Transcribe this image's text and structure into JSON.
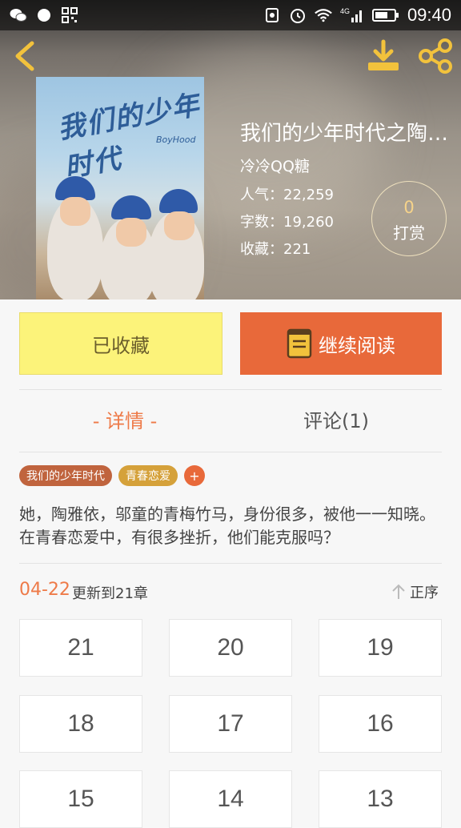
{
  "status_bar": {
    "time": "09:40",
    "network": "4G"
  },
  "book": {
    "cover_title": "我们的少年时代",
    "cover_subtitle": "BoyHood",
    "title": "我们的少年时代之陶…",
    "author": "冷冷QQ糖",
    "popularity_label": "人气：",
    "popularity": "22,259",
    "word_count_label": "字数：",
    "word_count": "19,260",
    "favorites_label": "收藏：",
    "favorites": "221"
  },
  "tip": {
    "count": "0",
    "label": "打赏"
  },
  "actions": {
    "collect_label": "已收藏",
    "read_label": "继续阅读"
  },
  "tabs": {
    "detail": "- 详情 -",
    "comments": "评论(1)"
  },
  "tags": [
    {
      "label": "我们的少年时代",
      "color": "#c0643e"
    },
    {
      "label": "青春恋爱",
      "color": "#d5a13a"
    }
  ],
  "tag_add_label": "+",
  "description": "她，陶雅依，邬童的青梅竹马，身份很多，被他一一知晓。在青春恋爱中，有很多挫折，他们能克服吗？",
  "updates": {
    "date": "04-22",
    "text": "更新到21章",
    "sort_label": "正序"
  },
  "chapters": [
    "21",
    "20",
    "19",
    "18",
    "17",
    "16",
    "15",
    "14",
    "13"
  ],
  "colors": {
    "accent": "#e8693a",
    "collect_bg": "#fcf37a",
    "icon_yellow": "#f2c23c"
  }
}
